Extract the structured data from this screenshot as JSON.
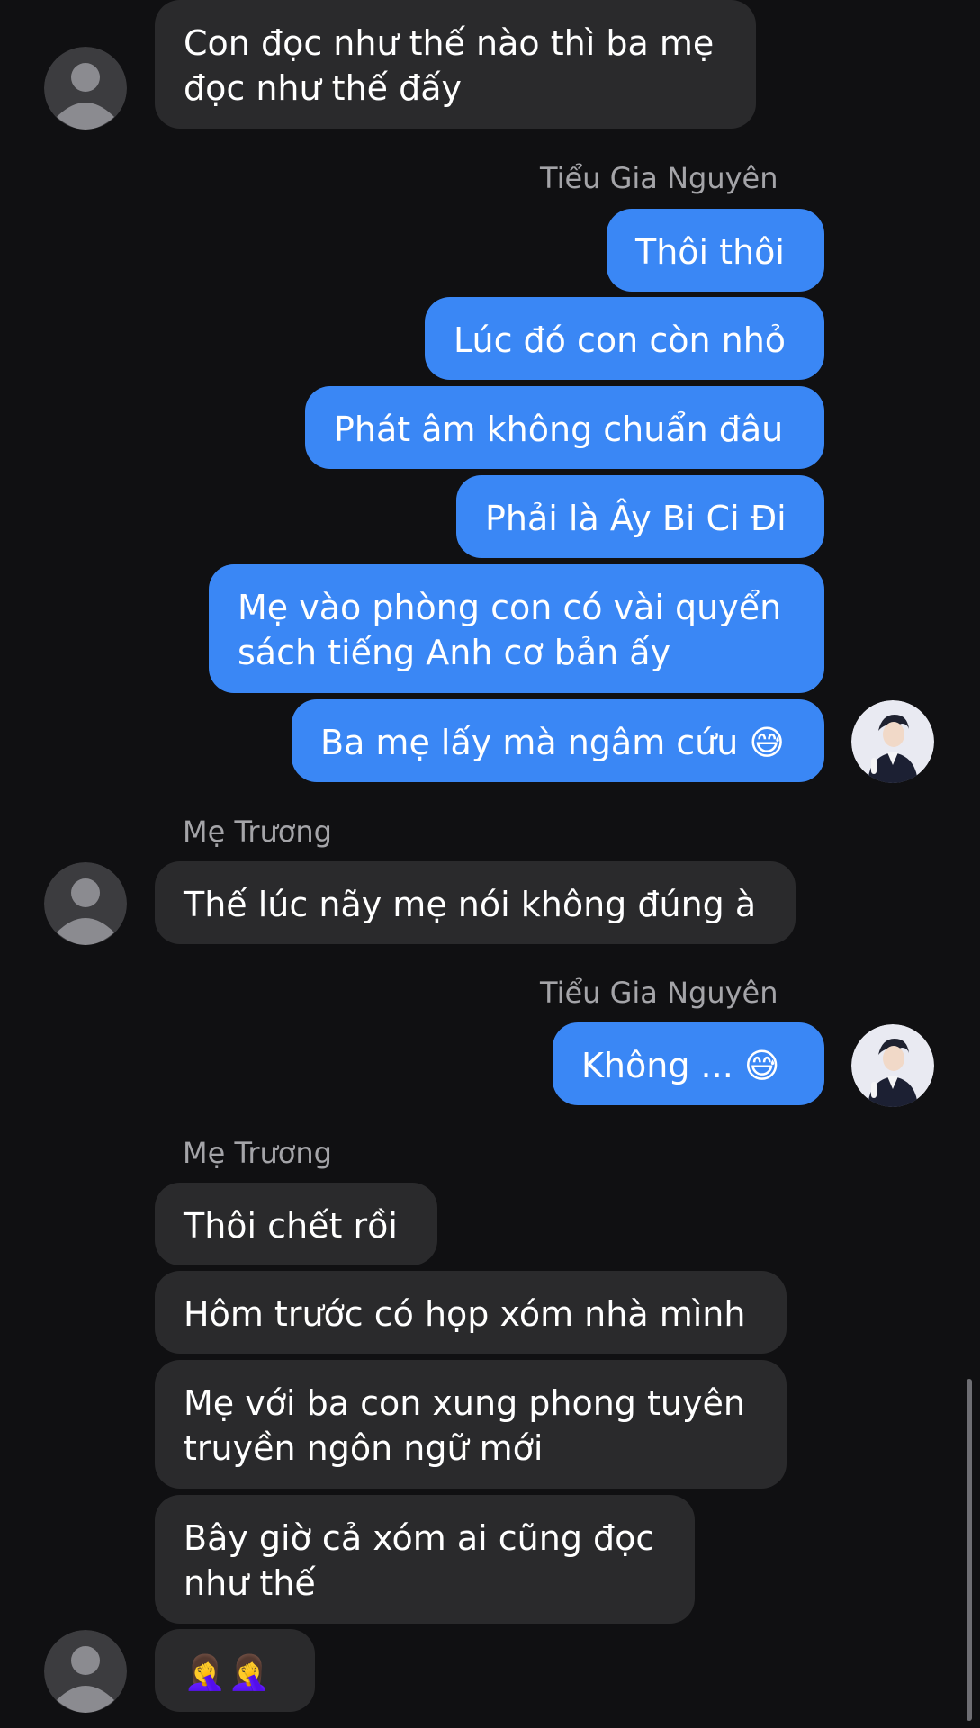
{
  "colors": {
    "background": "#101012",
    "incoming_bubble": "#2a2a2c",
    "outgoing_bubble": "#3a87f5",
    "sender_text": "#a4a4a8"
  },
  "messages": {
    "m1": "Con đọc như thế nào thì ba mẹ\nđọc như thế đấy",
    "s1": "Tiểu Gia Nguyên",
    "m2": "Thôi thôi",
    "m3": "Lúc đó con còn nhỏ",
    "m4": "Phát âm không chuẩn đâu",
    "m5": "Phải là Ây Bi Ci Đi",
    "m6": "Mẹ vào phòng con có vài quyển\nsách tiếng Anh cơ bản ấy",
    "m7": "Ba mẹ lấy mà ngâm cứu 😅",
    "s2": "Mẹ Trương",
    "m8": "Thế lúc nãy mẹ nói không đúng à",
    "s3": "Tiểu Gia Nguyên",
    "m9": "Không ... 😅",
    "s4": "Mẹ Trương",
    "m10": "Thôi chết rồi",
    "m11": "Hôm trước có họp xóm nhà mình",
    "m12": "Mẹ với ba con xung phong tuyên\ntruyền ngôn ngữ mới",
    "m13": "Bây giờ cả xóm ai cũng đọc\nnhư thế",
    "m14": "🤦‍♀️🤦‍♀️"
  },
  "avatars": {
    "incoming": "default-person-icon",
    "outgoing": "profile-photo"
  }
}
